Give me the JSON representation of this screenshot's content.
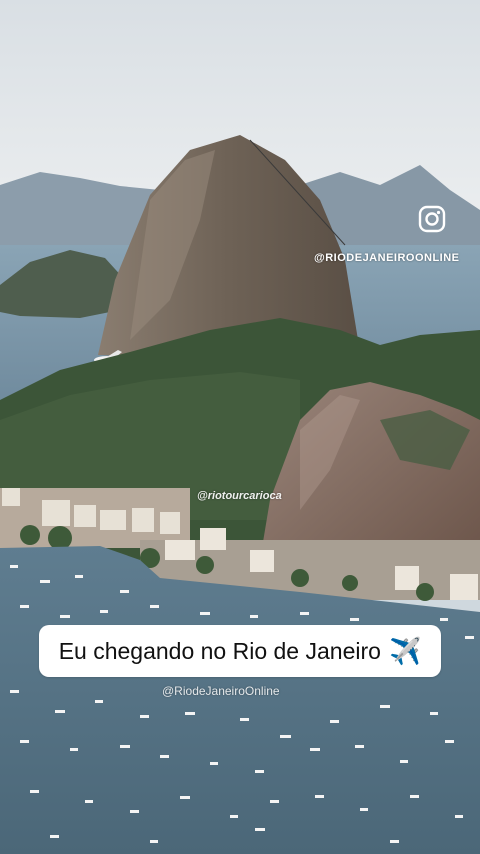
{
  "overlay": {
    "instagram_icon": "instagram-icon",
    "instagram_handle": "@RIODEJANEIROONLINE",
    "watermark_top": "@riotourcarioca",
    "caption": "Eu chegando no Rio de Janeiro",
    "caption_emoji": "✈️",
    "watermark_bottom": "@RiodeJaneiroOnline"
  }
}
